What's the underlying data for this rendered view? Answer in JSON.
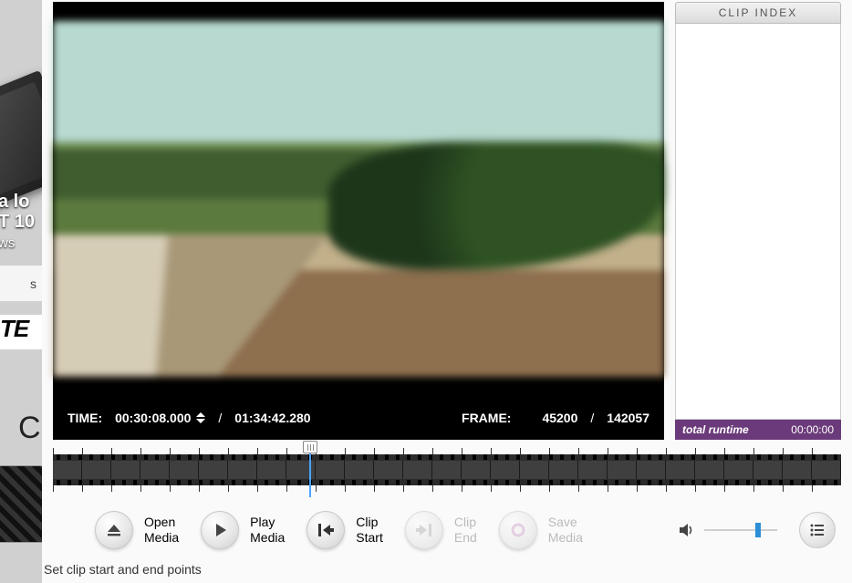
{
  "bg": {
    "tag_top": "a lo",
    "tag_mid": "T 10",
    "tag_small": "ws",
    "block_a": "s",
    "block_b": "TE",
    "letter": "C"
  },
  "player": {
    "time_label": "TIME:",
    "time_current": "00:30:08.000",
    "time_total": "01:34:42.280",
    "frame_label": "FRAME:",
    "frame_current": "45200",
    "frame_total": "142057",
    "separator": "/"
  },
  "clip_panel": {
    "header": "CLIP INDEX",
    "footer_label": "total runtime",
    "footer_value": "00:00:00"
  },
  "toolbar": {
    "open": {
      "l1": "Open",
      "l2": "Media"
    },
    "play": {
      "l1": "Play",
      "l2": "Media"
    },
    "clipstart": {
      "l1": "Clip",
      "l2": "Start"
    },
    "clipend": {
      "l1": "Clip",
      "l2": "End"
    },
    "save": {
      "l1": "Save",
      "l2": "Media"
    }
  },
  "status": "Set clip start and end points"
}
